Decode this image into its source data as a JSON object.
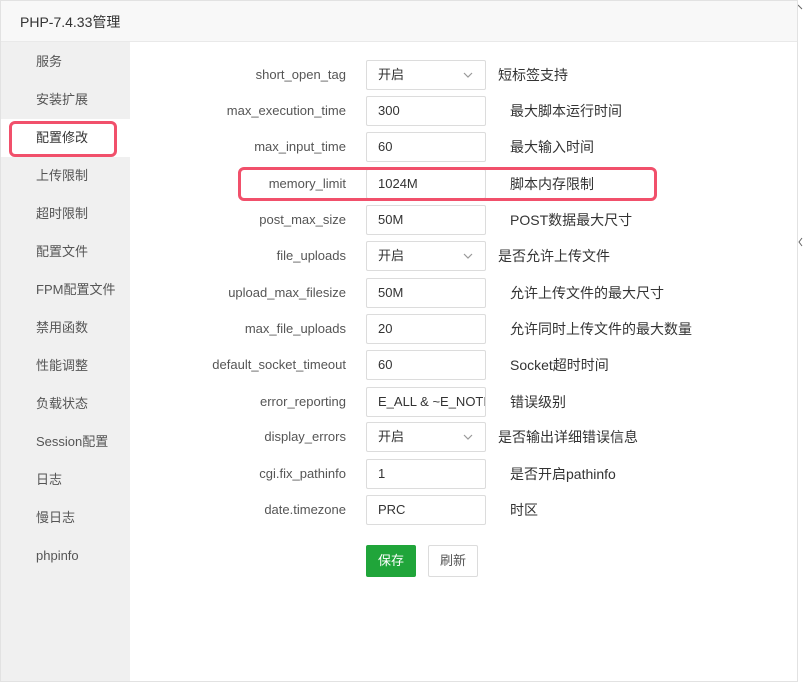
{
  "window": {
    "title": "PHP-7.4.33管理"
  },
  "sidebar": {
    "active_index": 2,
    "items": [
      {
        "label": "服务"
      },
      {
        "label": "安装扩展"
      },
      {
        "label": "配置修改"
      },
      {
        "label": "上传限制"
      },
      {
        "label": "超时限制"
      },
      {
        "label": "配置文件"
      },
      {
        "label": "FPM配置文件"
      },
      {
        "label": "禁用函数"
      },
      {
        "label": "性能调整"
      },
      {
        "label": "负载状态"
      },
      {
        "label": "Session配置"
      },
      {
        "label": "日志"
      },
      {
        "label": "慢日志"
      },
      {
        "label": "phpinfo"
      }
    ]
  },
  "settings": [
    {
      "key": "short_open_tag",
      "type": "select",
      "value": "开启",
      "desc": "短标签支持"
    },
    {
      "key": "max_execution_time",
      "type": "input",
      "value": "300",
      "desc": "最大脚本运行时间"
    },
    {
      "key": "max_input_time",
      "type": "input",
      "value": "60",
      "desc": "最大输入时间"
    },
    {
      "key": "memory_limit",
      "type": "input",
      "value": "1024M",
      "desc": "脚本内存限制",
      "highlighted": true
    },
    {
      "key": "post_max_size",
      "type": "input",
      "value": "50M",
      "desc": "POST数据最大尺寸"
    },
    {
      "key": "file_uploads",
      "type": "select",
      "value": "开启",
      "desc": "是否允许上传文件"
    },
    {
      "key": "upload_max_filesize",
      "type": "input",
      "value": "50M",
      "desc": "允许上传文件的最大尺寸"
    },
    {
      "key": "max_file_uploads",
      "type": "input",
      "value": "20",
      "desc": "允许同时上传文件的最大数量"
    },
    {
      "key": "default_socket_timeout",
      "type": "input",
      "value": "60",
      "desc": "Socket超时时间"
    },
    {
      "key": "error_reporting",
      "type": "input",
      "value": "E_ALL & ~E_NOTICE",
      "desc": "错误级别"
    },
    {
      "key": "display_errors",
      "type": "select",
      "value": "开启",
      "desc": "是否输出详细错误信息"
    },
    {
      "key": "cgi.fix_pathinfo",
      "type": "input",
      "value": "1",
      "desc": "是否开启pathinfo"
    },
    {
      "key": "date.timezone",
      "type": "input",
      "value": "PRC",
      "desc": "时区"
    }
  ],
  "actions": {
    "save_label": "保存",
    "refresh_label": "刷新"
  },
  "colors": {
    "accent": "#20a53a",
    "highlight": "#f1506b",
    "sidebar_bg": "#f0f0f0"
  },
  "icons": {
    "select_arrow": "chevron-down-icon"
  }
}
